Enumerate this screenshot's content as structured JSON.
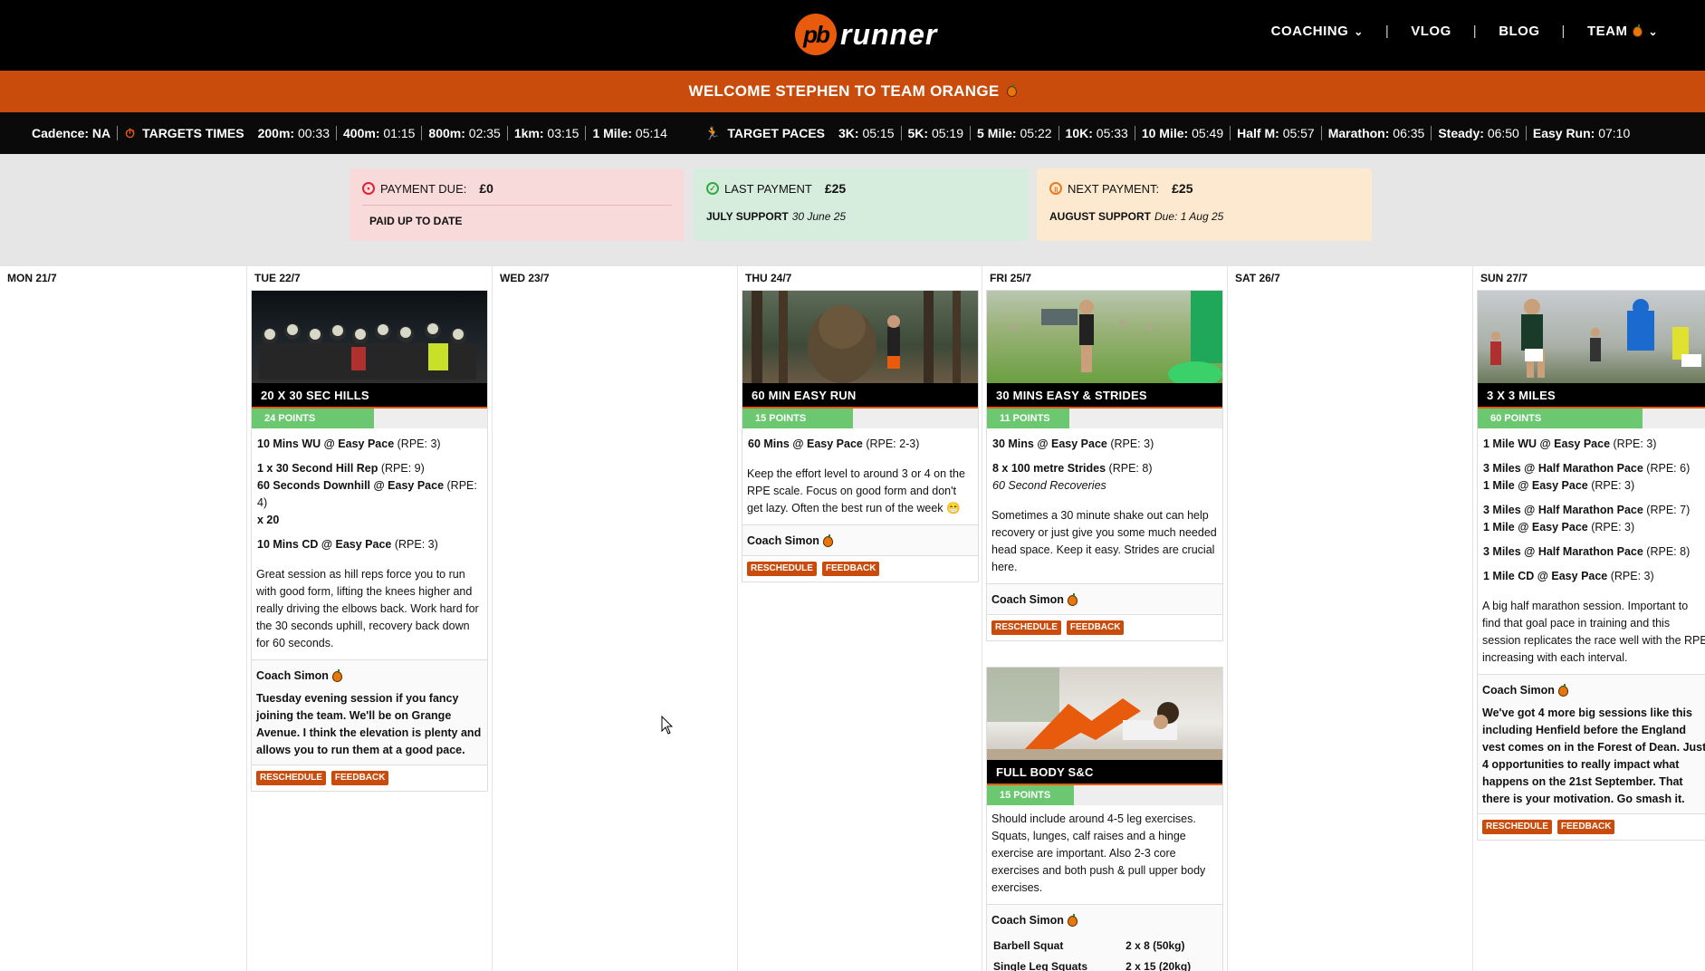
{
  "header": {
    "logo_pb": "pb",
    "logo_word": "runner",
    "nav": [
      {
        "label": "COACHING",
        "has_chevron": true
      },
      {
        "label": "VLOG"
      },
      {
        "label": "BLOG"
      },
      {
        "label": "TEAM",
        "has_chevron": true,
        "icon": "orange-icon"
      }
    ],
    "separator": "|"
  },
  "welcome": {
    "text": "WELCOME STEPHEN TO TEAM ORANGE"
  },
  "targets": {
    "cadence_label": "Cadence:",
    "cadence_value": "NA",
    "times_label": "TARGETS TIMES",
    "times": [
      {
        "label": "200m:",
        "value": "00:33"
      },
      {
        "label": "400m:",
        "value": "01:15"
      },
      {
        "label": "800m:",
        "value": "02:35"
      },
      {
        "label": "1km:",
        "value": "03:15"
      },
      {
        "label": "1 Mile:",
        "value": "05:14"
      }
    ],
    "paces_label": "TARGET PACES",
    "paces": [
      {
        "label": "3K:",
        "value": "05:15"
      },
      {
        "label": "5K:",
        "value": "05:19"
      },
      {
        "label": "5 Mile:",
        "value": "05:22"
      },
      {
        "label": "10K:",
        "value": "05:33"
      },
      {
        "label": "10 Mile:",
        "value": "05:49"
      },
      {
        "label": "Half M:",
        "value": "05:57"
      },
      {
        "label": "Marathon:",
        "value": "06:35"
      },
      {
        "label": "Steady:",
        "value": "06:50"
      },
      {
        "label": "Easy Run:",
        "value": "07:10"
      }
    ]
  },
  "payments": {
    "due": {
      "label": "PAYMENT DUE:",
      "amount": "£0",
      "status": "PAID UP TO DATE"
    },
    "last": {
      "label": "LAST PAYMENT",
      "amount": "£25",
      "desc": "JULY SUPPORT",
      "date": "30 June 25"
    },
    "next": {
      "label": "NEXT PAYMENT:",
      "amount": "£25",
      "desc": "AUGUST SUPPORT",
      "date": "Due: 1 Aug 25"
    }
  },
  "days": [
    "MON 21/7",
    "TUE 22/7",
    "WED 23/7",
    "THU 24/7",
    "FRI 25/7",
    "SAT 26/7",
    "SUN 27/7"
  ],
  "coach_name": "Coach Simon",
  "reschedule_label": "RESCHEDULE",
  "feedback_label": "FEEDBACK",
  "sessions": {
    "tue": {
      "title": "20 X 30 SEC HILLS",
      "points": "24 POINTS",
      "points_fraction": 0.52,
      "steps": [
        {
          "b": "10 Mins WU @ Easy Pace",
          "t": " (RPE: 3)"
        },
        {
          "b": "1 x 30 Second Hill Rep",
          "t": " (RPE: 9)"
        },
        {
          "b": "60 Seconds Downhill @ Easy Pace",
          "t": " (RPE: 4)"
        },
        {
          "b": "x 20",
          "t": ""
        },
        {
          "b": "10 Mins CD @ Easy Pace",
          "t": " (RPE: 3)"
        }
      ],
      "desc": "Great session as hill reps force you to run with good form, lifting the knees higher and really driving the elbows back. Work hard for the 30 seconds uphill, recovery back down for 60 seconds.",
      "coach_msg": "Tuesday evening session if you fancy joining the team. We'll be on Grange Avenue. I think the elevation is plenty and allows you to run them at a good pace."
    },
    "thu": {
      "title": "60 MIN EASY RUN",
      "points": "15 POINTS",
      "points_fraction": 0.47,
      "steps": [
        {
          "b": "60 Mins @ Easy Pace",
          "t": " (RPE: 2-3)"
        }
      ],
      "desc": "Keep the effort level to around 3 or 4 on the RPE scale. Focus on good form and don't get lazy. Often the best run of the week 😁"
    },
    "fri": {
      "title": "30 MINS EASY & STRIDES",
      "points": "11 POINTS",
      "points_fraction": 0.35,
      "steps": [
        {
          "b": "30 Mins @ Easy Pace",
          "t": " (RPE: 3)"
        },
        {
          "b": "8 x 100 metre Strides",
          "t": " (RPE: 8)"
        }
      ],
      "steps_note": "60 Second Recoveries",
      "desc": "Sometimes a 30 minute shake out can help recovery or just give you some much needed head space. Keep it easy. Strides are crucial here."
    },
    "fri2": {
      "title": "FULL BODY S&C",
      "points": "15 POINTS",
      "points_fraction": 0.37,
      "desc": "Should include around 4-5 leg exercises. Squats, lunges, calf raises and a hinge exercise are important. Also 2-3 core exercises and both push & pull upper body exercises.",
      "exercises": [
        {
          "name": "Barbell Squat",
          "sets": "2 x 8 (50kg)"
        },
        {
          "name": "Single Leg Squats",
          "sets": "2 x 15 (20kg)"
        }
      ]
    },
    "sun": {
      "title": "3 X 3 MILES",
      "points": "60 POINTS",
      "points_fraction": 0.7,
      "steps": [
        {
          "b": "1 Mile WU @ Easy Pace",
          "t": " (RPE: 3)"
        },
        {
          "b": "3 Miles @ Half Marathon Pace",
          "t": " (RPE: 6)"
        },
        {
          "b": "1 Mile @ Easy Pace",
          "t": " (RPE: 3)"
        },
        {
          "b": "3 Miles @ Half Marathon Pace",
          "t": " (RPE: 7)"
        },
        {
          "b": "1 Mile @ Easy Pace",
          "t": " (RPE: 3)"
        },
        {
          "b": "3 Miles @ Half Marathon Pace",
          "t": " (RPE: 8)"
        },
        {
          "b": "1 Mile CD @ Easy Pace",
          "t": " (RPE: 3)"
        }
      ],
      "desc": "A big half marathon session. Important to find that goal pace in training and this session replicates the race well with the RPE increasing with each interval.",
      "coach_msg": "We've got 4 more big sessions like this including Henfield before the England vest comes on in the Forest of Dean. Just 4 opportunities to really impact what happens on the 21st September. That there is your motivation. Go smash it."
    }
  },
  "colors": {
    "brand_orange": "#c94c0c",
    "points_green": "#6cc870",
    "black": "#000000"
  }
}
